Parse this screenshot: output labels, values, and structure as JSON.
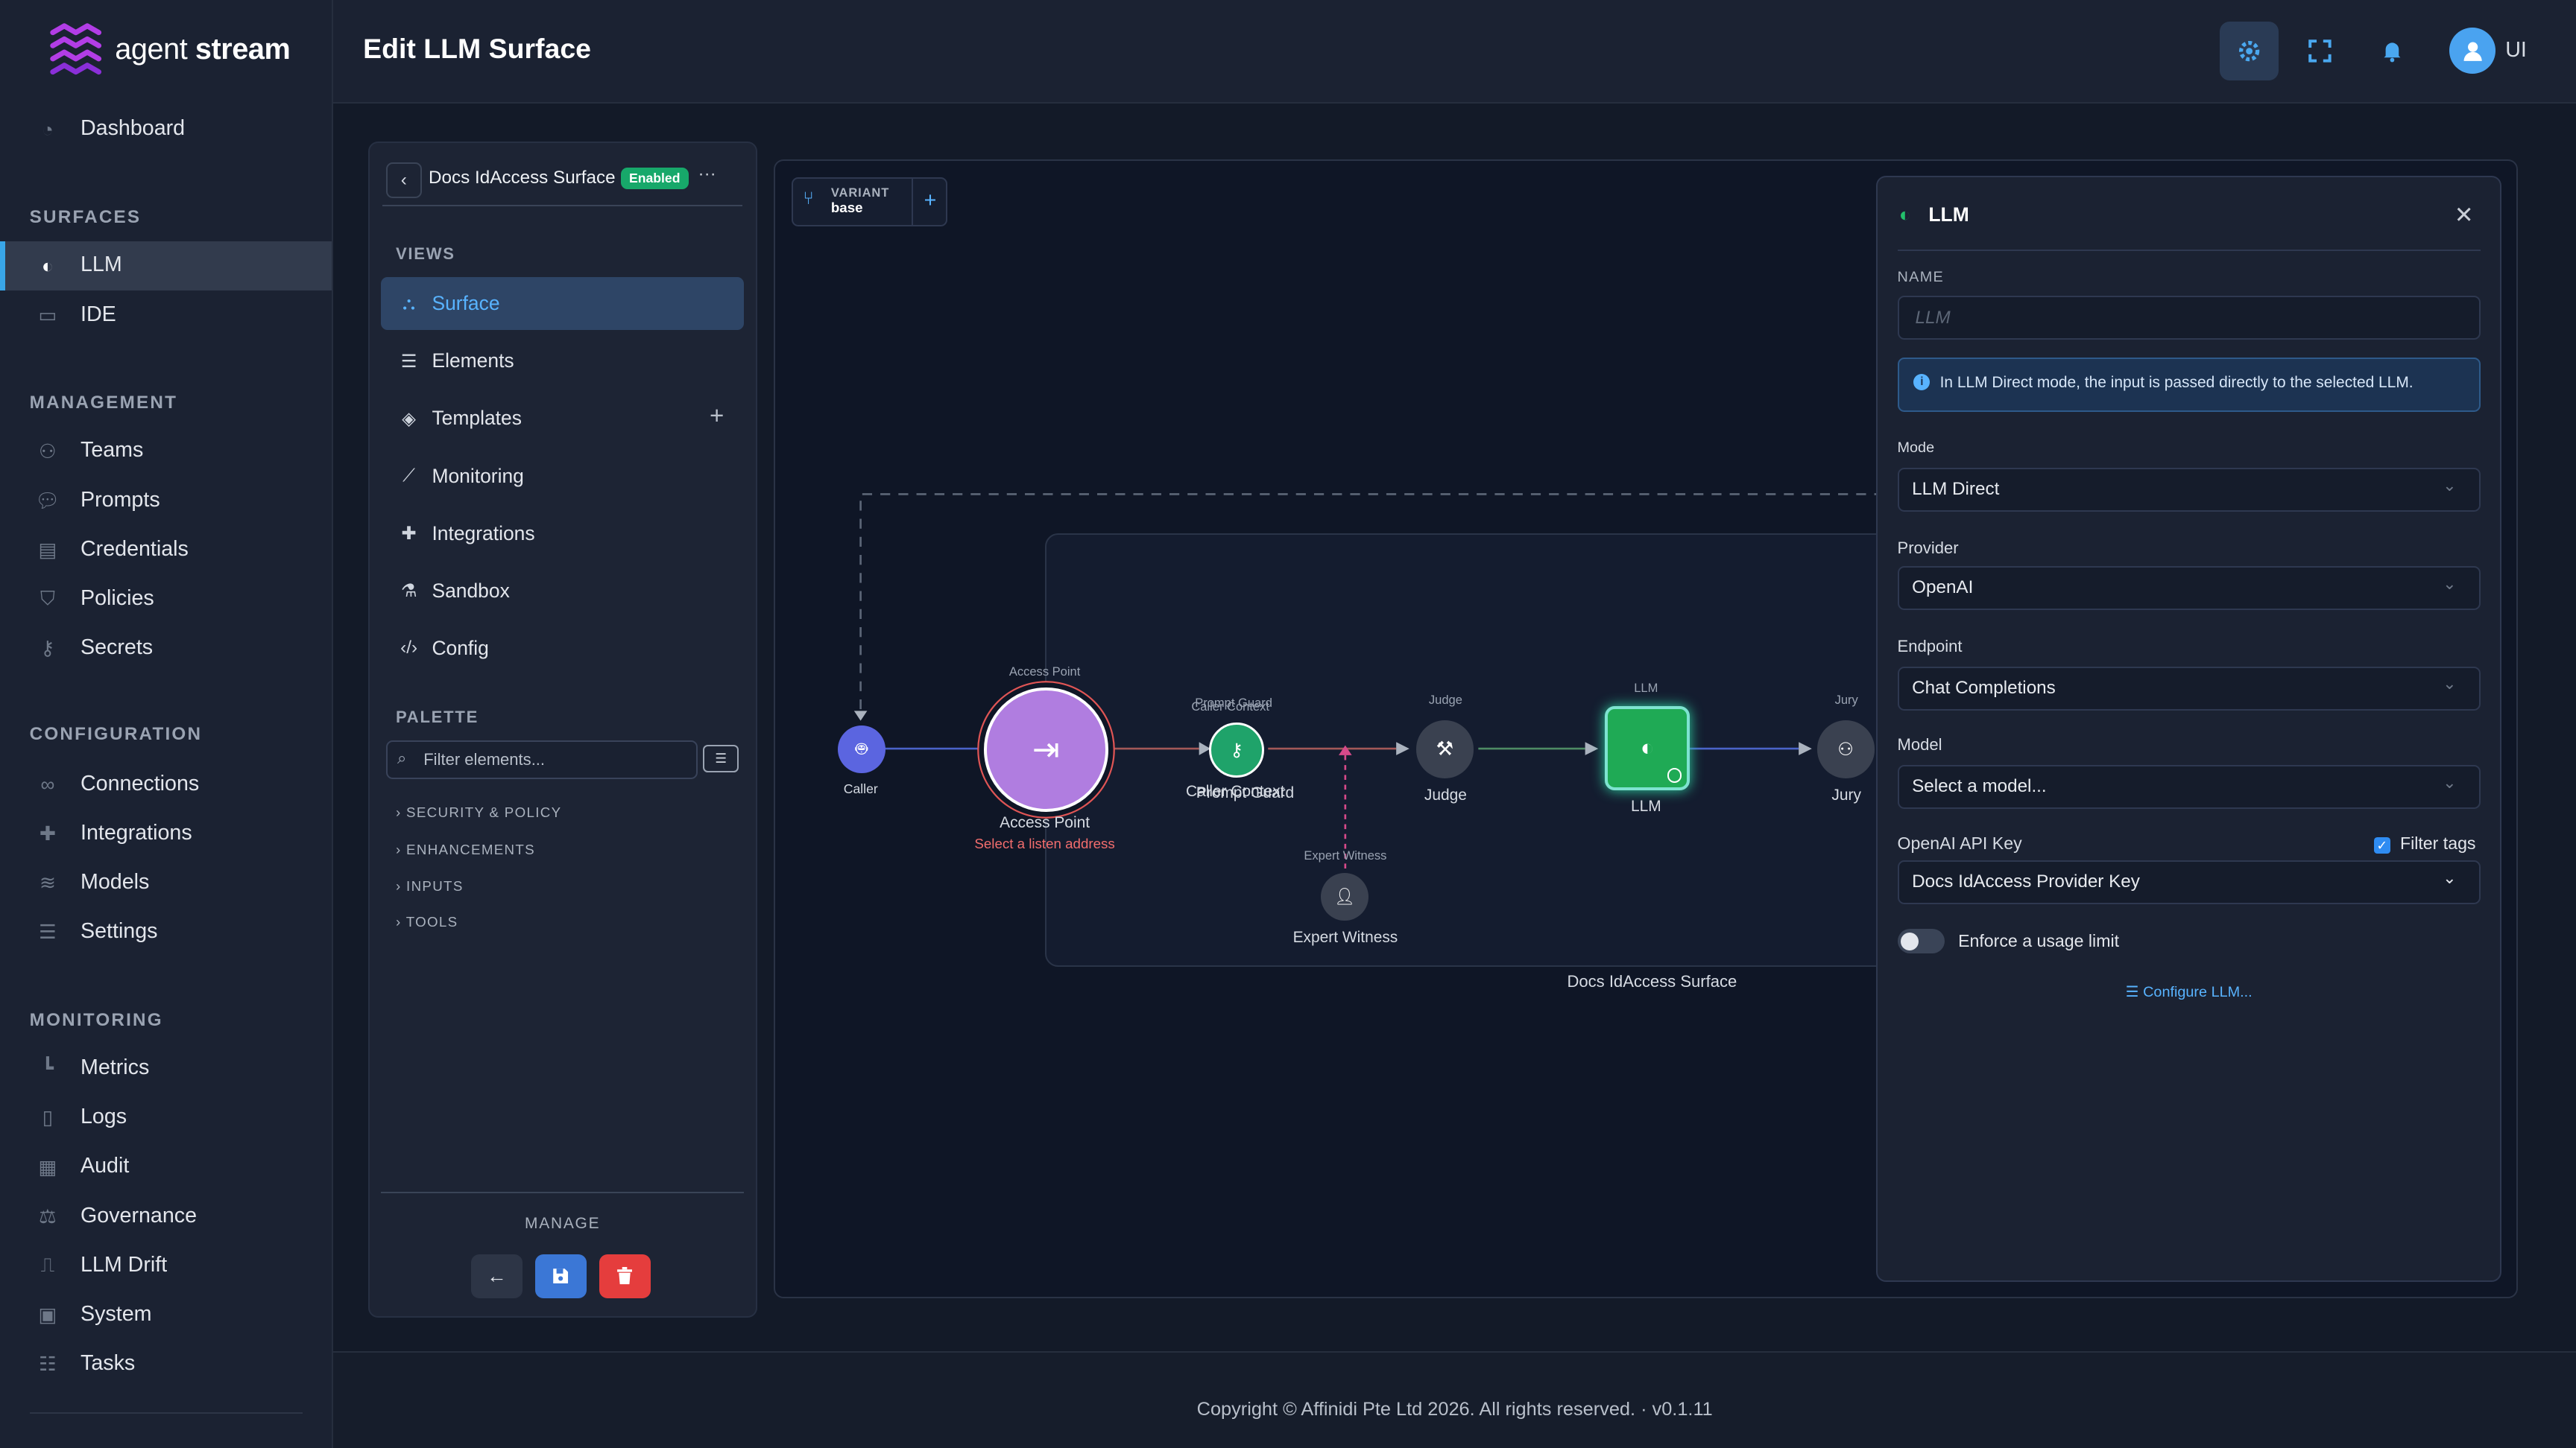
{
  "brand": {
    "name_light": "agent",
    "name_bold": "stream"
  },
  "sidebar": {
    "dashboard": {
      "label": "Dashboard",
      "icon": "dashboard-icon"
    },
    "sections": {
      "surfaces": "SURFACES",
      "management": "MANAGEMENT",
      "configuration": "CONFIGURATION",
      "monitoring": "MONITORING"
    },
    "surfaces": [
      {
        "label": "LLM",
        "icon": "brain-icon",
        "active": true
      },
      {
        "label": "IDE",
        "icon": "code-screen-icon"
      }
    ],
    "management": [
      {
        "label": "Teams",
        "icon": "users-icon"
      },
      {
        "label": "Prompts",
        "icon": "chat-bubble-icon"
      },
      {
        "label": "Credentials",
        "icon": "id-card-icon"
      },
      {
        "label": "Policies",
        "icon": "shield-icon"
      },
      {
        "label": "Secrets",
        "icon": "key-icon"
      }
    ],
    "configuration": [
      {
        "label": "Connections",
        "icon": "link-icon"
      },
      {
        "label": "Integrations",
        "icon": "puzzle-icon"
      },
      {
        "label": "Models",
        "icon": "layers-icon"
      },
      {
        "label": "Settings",
        "icon": "sliders-icon"
      }
    ],
    "monitoring": [
      {
        "label": "Metrics",
        "icon": "chart-icon"
      },
      {
        "label": "Logs",
        "icon": "file-icon"
      },
      {
        "label": "Audit",
        "icon": "clipboard-icon"
      },
      {
        "label": "Governance",
        "icon": "gavel-icon"
      },
      {
        "label": "LLM Drift",
        "icon": "drift-icon"
      },
      {
        "label": "System",
        "icon": "chip-icon"
      },
      {
        "label": "Tasks",
        "icon": "list-check-icon"
      }
    ]
  },
  "header": {
    "title": "Edit LLM Surface",
    "user_initials": "UI"
  },
  "surface_panel": {
    "title": "Docs IdAccess Surface",
    "status_badge": "Enabled",
    "more": "···",
    "views_title": "VIEWS",
    "views": [
      {
        "label": "Surface",
        "icon": "graph-icon",
        "active": true
      },
      {
        "label": "Elements",
        "icon": "list-icon"
      },
      {
        "label": "Templates",
        "icon": "stack-icon"
      },
      {
        "label": "Monitoring",
        "icon": "line-chart-icon"
      },
      {
        "label": "Integrations",
        "icon": "puzzle-icon"
      },
      {
        "label": "Sandbox",
        "icon": "flask-icon"
      },
      {
        "label": "Config",
        "icon": "code-icon"
      }
    ],
    "palette_title": "PALETTE",
    "filter_placeholder": "Filter elements...",
    "categories": [
      "SECURITY & POLICY",
      "ENHANCEMENTS",
      "INPUTS",
      "TOOLS"
    ],
    "manage_title": "MANAGE"
  },
  "canvas": {
    "variant_label": "VARIANT",
    "variant_value": "base",
    "group_label": "Docs IdAccess Surface",
    "nodes": {
      "caller": {
        "label": "Caller"
      },
      "access_point": {
        "top": "Access Point",
        "label": "Access Point",
        "warning": "Select a listen address"
      },
      "caller_context": {
        "top": "Caller Context",
        "label": "Caller Context"
      },
      "prompt_guard": {
        "top": "Prompt Guard",
        "label": "Prompt Guard"
      },
      "judge": {
        "top": "Judge",
        "label": "Judge"
      },
      "llm": {
        "top": "LLM",
        "label": "LLM"
      },
      "jury": {
        "top": "Jury",
        "label": "Jury"
      },
      "expert_witness": {
        "top": "Expert Witness",
        "label": "Expert Witness"
      }
    }
  },
  "properties": {
    "title": "LLM",
    "name_label": "NAME",
    "name_placeholder": "LLM",
    "info": "In LLM Direct mode, the input is passed directly to the selected LLM.",
    "mode_label": "Mode",
    "mode_value": "LLM Direct",
    "provider_label": "Provider",
    "provider_value": "OpenAI",
    "endpoint_label": "Endpoint",
    "endpoint_value": "Chat Completions",
    "model_label": "Model",
    "model_value": "Select a model...",
    "api_key_label": "OpenAI API Key",
    "filter_tags_label": "Filter tags",
    "filter_tags_checked": true,
    "api_key_value": "Docs IdAccess Provider Key",
    "usage_limit_label": "Enforce a usage limit",
    "usage_limit_enabled": false,
    "configure_link": "Configure LLM..."
  },
  "footer": {
    "copyright": "Copyright © Affinidi Pte Ltd 2026. All rights reserved. · v0.1.11"
  },
  "colors": {
    "accent": "#4aa8f0",
    "active_nav": "#323b4d",
    "enabled_badge": "#17a86a",
    "access_point": "#b07de0",
    "llm_node": "#1faa55",
    "warning": "#f26d6d",
    "delete": "#e53d3d",
    "save": "#3b77d6"
  }
}
